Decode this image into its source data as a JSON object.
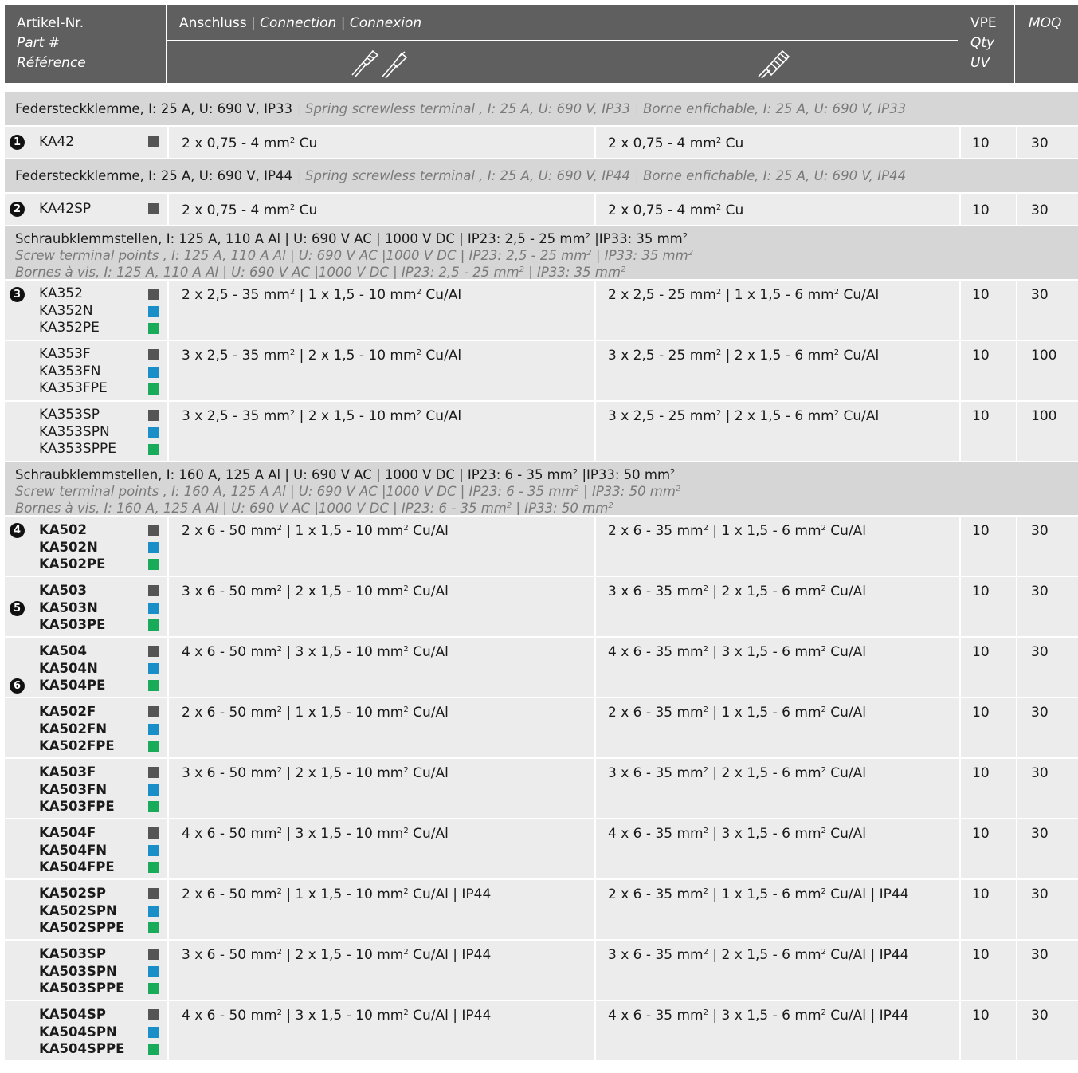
{
  "header": {
    "article": [
      "Artikel-Nr.",
      "Part #",
      "Référence"
    ],
    "connection": {
      "de": "Anschluss",
      "en": "Connection",
      "fr": "Connexion"
    },
    "vpe": [
      "VPE",
      "Qty",
      "UV"
    ],
    "moq": "MOQ"
  },
  "icons": {
    "left": "wire-ferrule-icon",
    "right": "stranded-wire-icon"
  },
  "colors": {
    "header": "#5f5f5f",
    "section": "#d6d6d6",
    "row": "#ececec",
    "grey": "#555555",
    "blue": "#1a8fc7",
    "green": "#1aab5a"
  },
  "sections": [
    {
      "lines": [
        "Federsteckklemme, I: 25 A, U: 690 V, IP33",
        "Spring screwless terminal , I: 25 A, U: 690 V, IP33",
        "Borne enfichable, I: 25 A, U: 690 V, IP33"
      ],
      "rows": [
        {
          "articles": [
            "KA42"
          ],
          "num": "1",
          "num_line": 0,
          "swatches": [
            "g"
          ],
          "left": "2 x 0,75 - 4 mm",
          "left_sup": "2",
          "left_tail": " Cu",
          "right": "2 x 0,75 - 4 mm",
          "right_sup": "2",
          "right_tail": " Cu",
          "vpe": "10",
          "moq": "30"
        }
      ]
    },
    {
      "lines": [
        "Federsteckklemme, I: 25 A, U: 690 V, IP44",
        "Spring screwless terminal , I: 25 A, U: 690 V, IP44",
        "Borne enfichable, I: 25 A, U: 690 V, IP44"
      ],
      "rows": [
        {
          "articles": [
            "KA42SP"
          ],
          "num": "2",
          "num_line": 0,
          "swatches": [
            "g"
          ],
          "left": "2 x 0,75 - 4 mm",
          "left_sup": "2",
          "left_tail": " Cu",
          "right": "2 x 0,75 - 4 mm",
          "right_sup": "2",
          "right_tail": " Cu",
          "vpe": "10",
          "moq": "30"
        }
      ]
    },
    {
      "lines": [
        "Schraubklemmstellen, I: 125 A, 110 A Al | U: 690 V AC | 1000 V DC | IP23: 2,5 - 25 mm² |IP33: 35 mm²",
        "Screw terminal points , I: 125 A, 110 A Al | U: 690 V AC |1000 V DC | IP23: 2,5 - 25 mm² | IP33: 35 mm²",
        "Bornes à vis, I: 125 A, 110 A Al | U: 690 V AC |1000 V DC | IP23: 2,5 - 25 mm² | IP33: 35 mm²"
      ],
      "rows": [
        {
          "articles": [
            "KA352",
            "KA352N",
            "KA352PE"
          ],
          "num": "3",
          "num_line": 0,
          "swatches": [
            "g",
            "b",
            "e"
          ],
          "left": "2 x 2,5 - 35 mm² | 1 x 1,5 - 10 mm² Cu/Al",
          "right": "2 x 2,5 - 25 mm² | 1 x 1,5 - 6 mm² Cu/Al",
          "vpe": "10",
          "moq": "30"
        },
        {
          "articles": [
            "KA353F",
            "KA353FN",
            "KA353FPE"
          ],
          "swatches": [
            "g",
            "b",
            "e"
          ],
          "left": "3 x 2,5 - 35 mm² | 2 x 1,5 - 10 mm² Cu/Al",
          "right": "3 x 2,5 - 25 mm² | 2 x 1,5 - 6 mm² Cu/Al",
          "vpe": "10",
          "moq": "100"
        },
        {
          "articles": [
            "KA353SP",
            "KA353SPN",
            "KA353SPPE"
          ],
          "swatches": [
            "g",
            "b",
            "e"
          ],
          "left": "3 x 2,5 - 35 mm² | 2 x 1,5 - 10 mm² Cu/Al",
          "right": "3 x 2,5 - 25 mm² | 2 x 1,5 - 6 mm² Cu/Al",
          "vpe": "10",
          "moq": "100"
        }
      ]
    },
    {
      "lines": [
        "Schraubklemmstellen, I: 160 A, 125 A Al | U: 690 V AC | 1000 V DC | IP23: 6 - 35 mm² |IP33: 50 mm²",
        "Screw terminal points , I: 160 A, 125 A Al | U: 690 V AC |1000 V DC | IP23: 6 - 35 mm² | IP33: 50 mm²",
        "Bornes à vis, I: 160 A, 125 A Al | U: 690 V AC |1000 V DC | IP23: 6 - 35 mm² | IP33: 50 mm²"
      ],
      "rows": [
        {
          "articles": [
            "KA502",
            "KA502N",
            "KA502PE"
          ],
          "bold": true,
          "num": "4",
          "num_line": 0,
          "swatches": [
            "g",
            "b",
            "e"
          ],
          "left": "2 x 6 - 50 mm² | 1 x 1,5 - 10 mm² Cu/Al",
          "right": "2 x 6 - 35 mm² | 1 x 1,5 - 6 mm² Cu/Al",
          "vpe": "10",
          "moq": "30"
        },
        {
          "articles": [
            "KA503",
            "KA503N",
            "KA503PE"
          ],
          "bold": true,
          "num": "5",
          "num_line": 1,
          "swatches": [
            "g",
            "b",
            "e"
          ],
          "left": "3 x 6 - 50 mm² | 2 x 1,5 - 10 mm² Cu/Al",
          "right": "3 x 6 - 35 mm² | 2 x 1,5 - 6 mm² Cu/Al",
          "vpe": "10",
          "moq": "30"
        },
        {
          "articles": [
            "KA504",
            "KA504N",
            "KA504PE"
          ],
          "bold": true,
          "num": "6",
          "num_line": 2,
          "swatches": [
            "g",
            "b",
            "e"
          ],
          "left": "4 x 6 - 50 mm² | 3 x 1,5 - 10 mm² Cu/Al",
          "right": "4 x 6 - 35 mm² | 3 x 1,5 - 6 mm² Cu/Al",
          "vpe": "10",
          "moq": "30"
        },
        {
          "articles": [
            "KA502F",
            "KA502FN",
            "KA502FPE"
          ],
          "bold": true,
          "swatches": [
            "g",
            "b",
            "e"
          ],
          "left": "2 x 6 - 50 mm² | 1 x 1,5 - 10 mm² Cu/Al",
          "right": "2 x 6 - 35 mm² | 1 x 1,5 - 6 mm² Cu/Al",
          "vpe": "10",
          "moq": "30"
        },
        {
          "articles": [
            "KA503F",
            "KA503FN",
            "KA503FPE"
          ],
          "bold": true,
          "swatches": [
            "g",
            "b",
            "e"
          ],
          "left": "3 x 6 - 50 mm² | 2 x 1,5 - 10 mm² Cu/Al",
          "right": "3 x 6 - 35 mm² | 2 x 1,5 - 6 mm² Cu/Al",
          "vpe": "10",
          "moq": "30"
        },
        {
          "articles": [
            "KA504F",
            "KA504FN",
            "KA504FPE"
          ],
          "bold": true,
          "swatches": [
            "g",
            "b",
            "e"
          ],
          "left": "4 x 6 - 50 mm² | 3 x 1,5 - 10 mm² Cu/Al",
          "right": "4 x 6 - 35 mm² | 3 x 1,5 - 6 mm² Cu/Al",
          "vpe": "10",
          "moq": "30"
        },
        {
          "articles": [
            "KA502SP",
            "KA502SPN",
            "KA502SPPE"
          ],
          "bold": true,
          "swatches": [
            "g",
            "b",
            "e"
          ],
          "left": "2 x 6 - 50 mm² | 1 x 1,5 - 10 mm² Cu/Al | IP44",
          "right": "2 x 6 - 35 mm² | 1 x 1,5 - 6 mm² Cu/Al | IP44",
          "vpe": "10",
          "moq": "30"
        },
        {
          "articles": [
            "KA503SP",
            "KA503SPN",
            "KA503SPPE"
          ],
          "bold": true,
          "swatches": [
            "g",
            "b",
            "e"
          ],
          "left": "3 x 6 - 50 mm² | 2 x 1,5 - 10 mm² Cu/Al | IP44",
          "right": "3 x 6 - 35 mm² | 2 x 1,5 - 6 mm² Cu/Al | IP44",
          "vpe": "10",
          "moq": "30"
        },
        {
          "articles": [
            "KA504SP",
            "KA504SPN",
            "KA504SPPE"
          ],
          "bold": true,
          "swatches": [
            "g",
            "b",
            "e"
          ],
          "left": "4 x 6 - 50 mm² | 3 x 1,5 - 10 mm² Cu/Al | IP44",
          "right": "4 x 6 - 35 mm² | 3 x 1,5 - 6 mm² Cu/Al | IP44",
          "vpe": "10",
          "moq": "30"
        }
      ]
    }
  ]
}
